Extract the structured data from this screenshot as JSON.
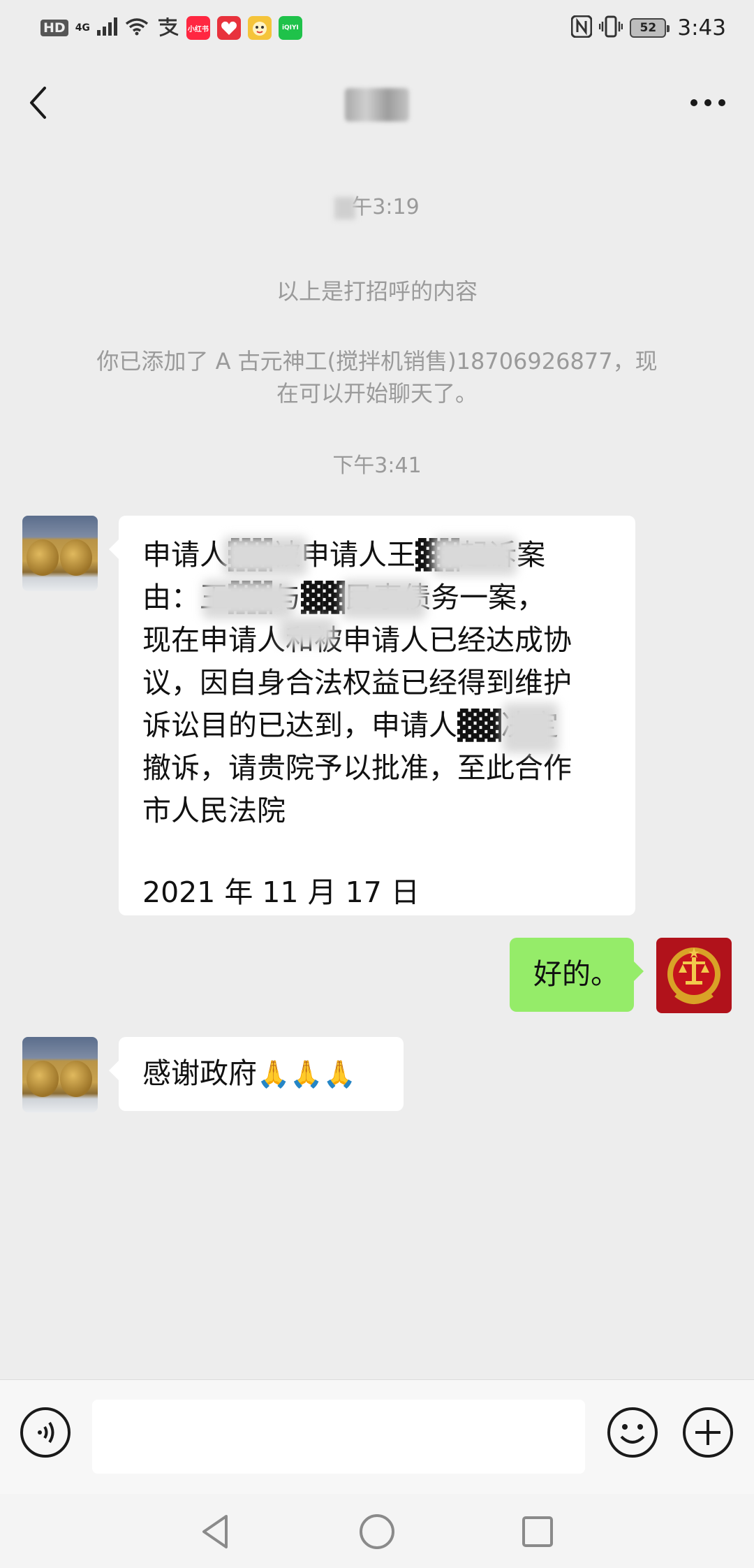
{
  "status_bar": {
    "hd": "HD",
    "network": "4G",
    "apps": [
      {
        "name": "小红书",
        "color": "#ff2741",
        "icon": "xiaohongshu-icon"
      },
      {
        "name": "",
        "color": "#e8323c",
        "icon": "heart-app-icon"
      },
      {
        "name": "",
        "color": "#f5c43a",
        "icon": "mascot-app-icon"
      },
      {
        "name": "iQIYI",
        "color": "#1fc24a",
        "icon": "iqiyi-icon"
      }
    ],
    "battery": "52",
    "time": "3:43"
  },
  "header": {
    "title": "▓▓"
  },
  "messages": {
    "time_1": "午3:19",
    "greeting_note": "以上是打招呼的内容",
    "added_note_line1": "你已添加了 A 古元神工(搅拌机销售)18706926877，现",
    "added_note_line2": "在可以开始聊天了。",
    "time_2": "下午3:41",
    "msg1_lines": [
      "申请人▓▓被申请人王▓▓起诉案",
      "由：王▓▓与▓▓民事债务一案，",
      "现在申请人和被申请人已经达成协",
      "议，因自身合法权益已经得到维护",
      "诉讼目的已达到，申请人▓▓决定",
      "撤诉，请贵院予以批准，至此合作",
      "市人民法院"
    ],
    "msg1_date": "2021 年 11 月 17 日",
    "msg2": "好的。",
    "msg3_text": "感谢政府",
    "msg3_emoji": "🙏🙏🙏"
  },
  "input": {
    "placeholder": ""
  }
}
